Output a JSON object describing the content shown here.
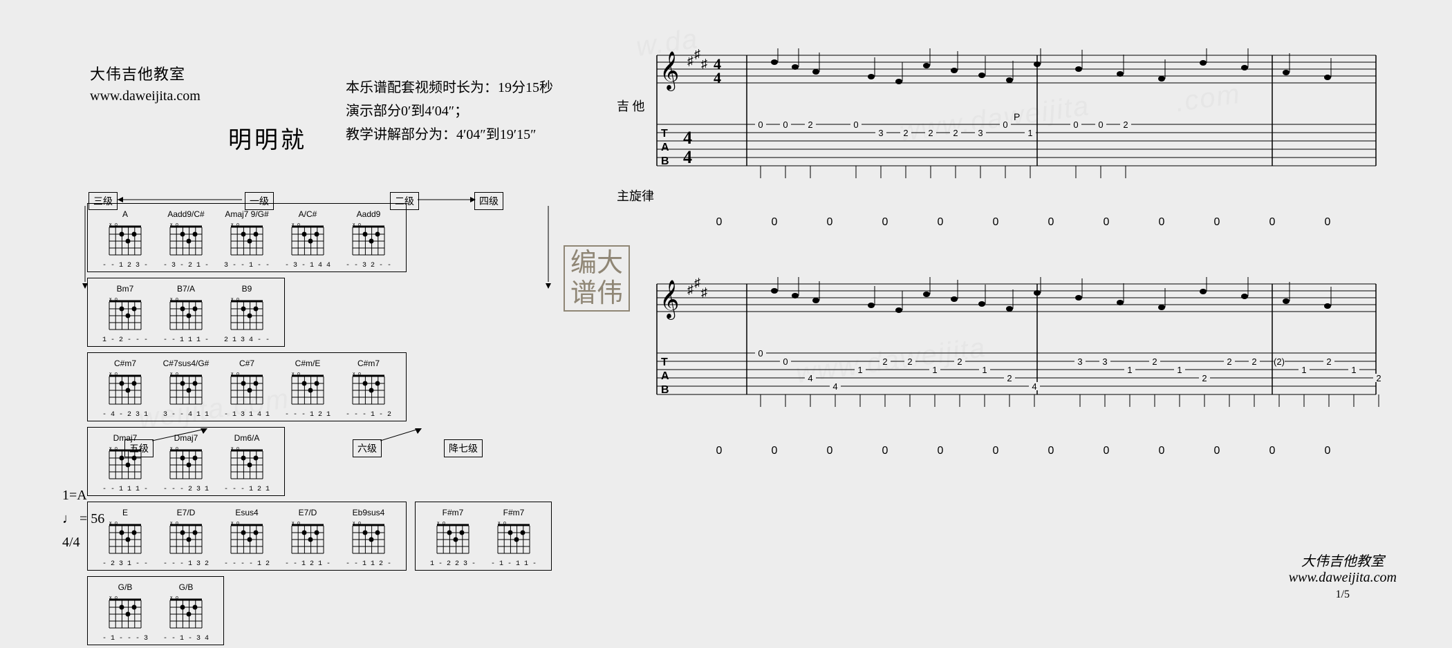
{
  "header": {
    "classroom": "大伟吉他教室",
    "website": "www.daweijita.com",
    "title": "明明就"
  },
  "video_info": {
    "line1": "本乐谱配套视频时长为：19分15秒",
    "line2": "演示部分0′到4′04″；",
    "line3": "教学讲解部分为：4′04″到19′15″"
  },
  "key_info": {
    "key": "1=A",
    "tempo": "♩ = 56",
    "time_sig": "4/4"
  },
  "degree_labels": {
    "d1": "一级",
    "d2": "二级",
    "d3": "三级",
    "d4": "四级",
    "d5": "五级",
    "d6": "六级",
    "b7": "降七级"
  },
  "chord_rows": [
    {
      "group_a": [
        {
          "name": "A",
          "fingering": "- - 1 2 3 -"
        },
        {
          "name": "Aadd9/C#",
          "fingering": "- 3 - 2 1 -"
        },
        {
          "name": "Amaj7 9/G#",
          "fingering": "3 - - 1 - -"
        },
        {
          "name": "A/C#",
          "fingering": "- 3 - 1 4 4"
        },
        {
          "name": "Aadd9",
          "fingering": "- - 3 2 - -"
        }
      ],
      "group_b": [
        {
          "name": "Bm7",
          "fingering": "1 - 2 - - -"
        },
        {
          "name": "B7/A",
          "fingering": "- - 1 1 1 -"
        },
        {
          "name": "B9",
          "fingering": "2 1 3 4 - -"
        }
      ]
    },
    {
      "group_a": [
        {
          "name": "C#m7",
          "fingering": "- 4 - 2 3 1"
        },
        {
          "name": "C#7sus4/G#",
          "fingering": "3 - - 4 1 1"
        },
        {
          "name": "C#7",
          "fingering": "- 1 3 1 4 1"
        },
        {
          "name": "C#m/E",
          "fingering": "- - - 1 2 1"
        },
        {
          "name": "C#m7",
          "fingering": "- - - 1 - 2"
        }
      ],
      "group_b": [
        {
          "name": "Dmaj7",
          "fingering": "- - 1 1 1 -"
        },
        {
          "name": "Dmaj7",
          "fingering": "- - - 2 3 1"
        },
        {
          "name": "Dm6/A",
          "fingering": "- - - 1 2 1"
        }
      ]
    },
    {
      "group_a": [
        {
          "name": "E",
          "fingering": "- 2 3 1 - -"
        },
        {
          "name": "E7/D",
          "fingering": "- - - 1 3 2"
        },
        {
          "name": "Esus4",
          "fingering": "- - - - 1 2"
        },
        {
          "name": "E7/D",
          "fingering": "- - 1 2 1 -"
        },
        {
          "name": "Eb9sus4",
          "fingering": "- - 1 1 2 -"
        }
      ],
      "group_b": [
        {
          "name": "F#m7",
          "fingering": "1 - 2 2 3 -"
        },
        {
          "name": "F#m7",
          "fingering": "- 1 - 1 1 -"
        }
      ],
      "group_c": [
        {
          "name": "G/B",
          "fingering": "- 1 - - - 3"
        },
        {
          "name": "G/B",
          "fingering": "- - 1 - 3 4"
        }
      ]
    }
  ],
  "stamp": {
    "line1": "编大",
    "line2": "谱伟"
  },
  "tracks": {
    "guitar": "吉 他",
    "melody": "主旋律"
  },
  "tab_data": {
    "system1": {
      "measures": [
        {
          "notes": [
            {
              "s": 1,
              "f": "0"
            },
            {
              "s": 1,
              "f": "0"
            },
            {
              "s": 1,
              "f": "2"
            }
          ]
        },
        {
          "notes": [
            {
              "s": 1,
              "f": "0"
            },
            {
              "s": 2,
              "f": "3"
            },
            {
              "s": 2,
              "f": "2"
            },
            {
              "s": 2,
              "f": "2"
            },
            {
              "s": 2,
              "f": "2"
            },
            {
              "s": 2,
              "f": "3"
            },
            {
              "s": 1,
              "f": "0"
            },
            {
              "s": 2,
              "f": "1"
            }
          ],
          "anno": "P"
        },
        {
          "notes": [
            {
              "s": 1,
              "f": "0"
            },
            {
              "s": 1,
              "f": "0"
            },
            {
              "s": 1,
              "f": "2"
            }
          ]
        }
      ],
      "melody": [
        "0",
        "0",
        "0",
        "0",
        "0",
        "0",
        "0",
        "0",
        "0",
        "0",
        "0",
        "0"
      ]
    },
    "system2": {
      "measures": [
        {
          "notes": [
            {
              "s": 1,
              "f": "0"
            },
            {
              "s": 2,
              "f": "0"
            },
            {
              "s": 4,
              "f": "4"
            },
            {
              "s": 5,
              "f": "4"
            },
            {
              "s": 3,
              "f": "1"
            },
            {
              "s": 2,
              "f": "2"
            },
            {
              "s": 2,
              "f": "2"
            },
            {
              "s": 3,
              "f": "1"
            },
            {
              "s": 2,
              "f": "2"
            },
            {
              "s": 3,
              "f": "1"
            },
            {
              "s": 4,
              "f": "2"
            },
            {
              "s": 5,
              "f": "4"
            }
          ]
        },
        {
          "notes": [
            {
              "s": 2,
              "f": "3"
            },
            {
              "s": 2,
              "f": "3"
            },
            {
              "s": 3,
              "f": "1"
            },
            {
              "s": 2,
              "f": "2"
            },
            {
              "s": 3,
              "f": "1"
            },
            {
              "s": 4,
              "f": "2"
            },
            {
              "s": 2,
              "f": "2"
            },
            {
              "s": 2,
              "f": "2"
            },
            {
              "s": 2,
              "f": "(2)"
            },
            {
              "s": 3,
              "f": "1"
            },
            {
              "s": 2,
              "f": "2"
            },
            {
              "s": 3,
              "f": "1"
            },
            {
              "s": 4,
              "f": "2"
            }
          ]
        },
        {
          "notes": []
        }
      ],
      "melody": [
        "0",
        "0",
        "0",
        "0",
        "0",
        "0",
        "0",
        "0",
        "0",
        "0",
        "0",
        "0"
      ]
    }
  },
  "footer": {
    "classroom": "大伟吉他教室",
    "website": "www.daweijita.com",
    "page": "1/5"
  }
}
